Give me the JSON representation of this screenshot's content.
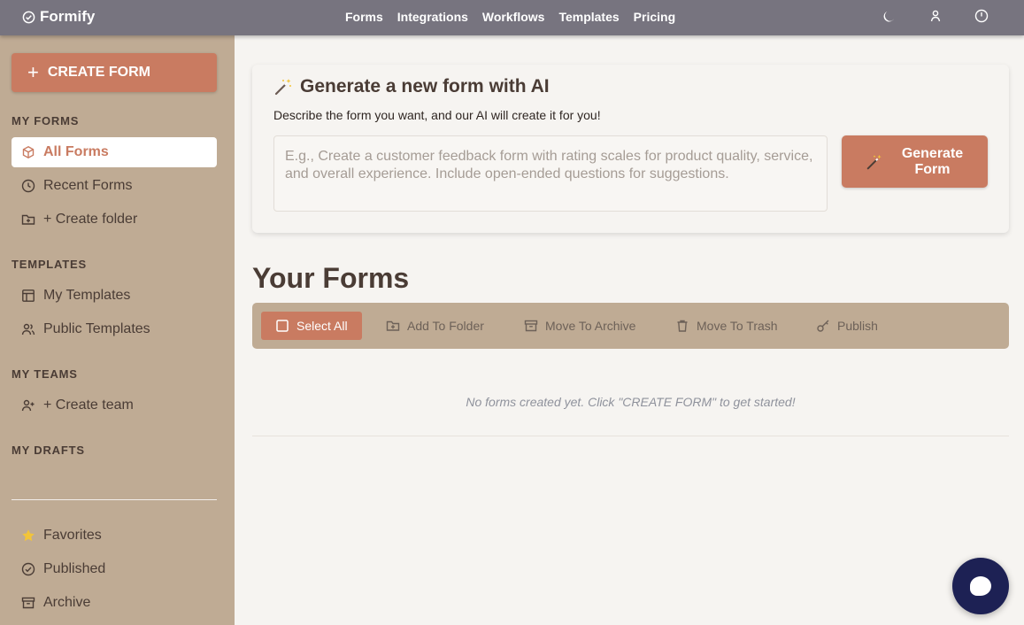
{
  "topbar": {
    "brand": "Formify",
    "nav": [
      "Forms",
      "Integrations",
      "Workflows",
      "Templates",
      "Pricing"
    ]
  },
  "sidebar": {
    "create_label": "CREATE FORM",
    "my_forms_title": "MY FORMS",
    "my_forms_items": [
      "All Forms",
      "Recent Forms",
      "+ Create folder"
    ],
    "templates_title": "TEMPLATES",
    "templates_items": [
      "My Templates",
      "Public Templates"
    ],
    "teams_title": "MY TEAMS",
    "teams_items": [
      "+ Create team"
    ],
    "drafts_title": "MY DRAFTS",
    "bottom_items": [
      "Favorites",
      "Published",
      "Archive"
    ]
  },
  "ai": {
    "title": "Generate a new form with AI",
    "description": "Describe the form you want, and our AI will create it for you!",
    "placeholder": "E.g., Create a customer feedback form with rating scales for product quality, service, and overall experience. Include open-ended questions for suggestions.",
    "button_label": "Generate Form"
  },
  "forms": {
    "title": "Your Forms",
    "toolbar": [
      "Select All",
      "Add To Folder",
      "Move To Archive",
      "Move To Trash",
      "Publish"
    ],
    "empty_message": "No forms created yet. Click \"CREATE FORM\" to get started!"
  },
  "colors": {
    "accent": "#c97b61",
    "sidebar": "#bfab94",
    "topbar": "#77747f",
    "chat": "#1d2154"
  }
}
